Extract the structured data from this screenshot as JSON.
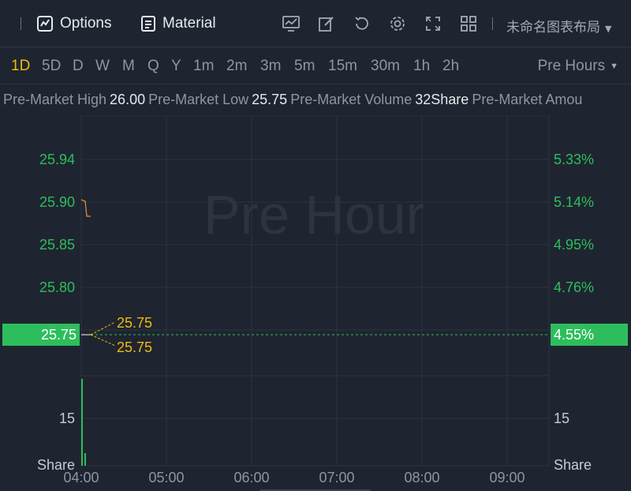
{
  "toolbar": {
    "options_label": "Options",
    "material_label": "Material",
    "layout_name": "未命名图表布局",
    "icons": [
      "chart-icon",
      "edit-icon",
      "refresh-icon",
      "settings-icon",
      "fullscreen-icon",
      "grid-icon"
    ]
  },
  "intervals": {
    "items": [
      "1D",
      "5D",
      "D",
      "W",
      "M",
      "Q",
      "Y",
      "1m",
      "2m",
      "3m",
      "5m",
      "15m",
      "30m",
      "1h",
      "2h"
    ],
    "active": "1D",
    "session_label": "Pre Hours"
  },
  "info": {
    "high_label": "Pre-Market High",
    "high_value": "26.00",
    "low_label": "Pre-Market Low",
    "low_value": "25.75",
    "volume_label": "Pre-Market Volume",
    "volume_value": "32Share",
    "amount_label": "Pre-Market Amou"
  },
  "chart": {
    "watermark": "Pre Hour",
    "left_ticks": [
      "25.94",
      "25.90",
      "25.85",
      "25.80"
    ],
    "right_ticks": [
      "5.33%",
      "5.14%",
      "4.95%",
      "4.76%"
    ],
    "current_price": "25.75",
    "current_pct": "4.55%",
    "annot_high": "25.75",
    "annot_low": "25.75",
    "volume_tick_left": "15",
    "volume_tick_right": "15",
    "volume_unit_left": "Share",
    "volume_unit_right": "Share",
    "time_ticks": [
      "04:00",
      "05:00",
      "06:00",
      "07:00",
      "08:00",
      "09:00"
    ],
    "colors": {
      "up": "#2ebd5d",
      "accent": "#f0b90b",
      "line": "#e08b3a",
      "grid": "#2b333e"
    }
  },
  "chart_data": {
    "type": "line",
    "price_series": [
      {
        "time": "04:00",
        "value": 25.9
      },
      {
        "time": "04:05",
        "value": 25.88
      }
    ],
    "volume": [
      {
        "time": "04:00",
        "value": 32
      },
      {
        "time": "04:02",
        "value": 4
      }
    ],
    "ylim": [
      25.75,
      25.94
    ],
    "x_categories": [
      "04:00",
      "05:00",
      "06:00",
      "07:00",
      "08:00",
      "09:00"
    ]
  }
}
